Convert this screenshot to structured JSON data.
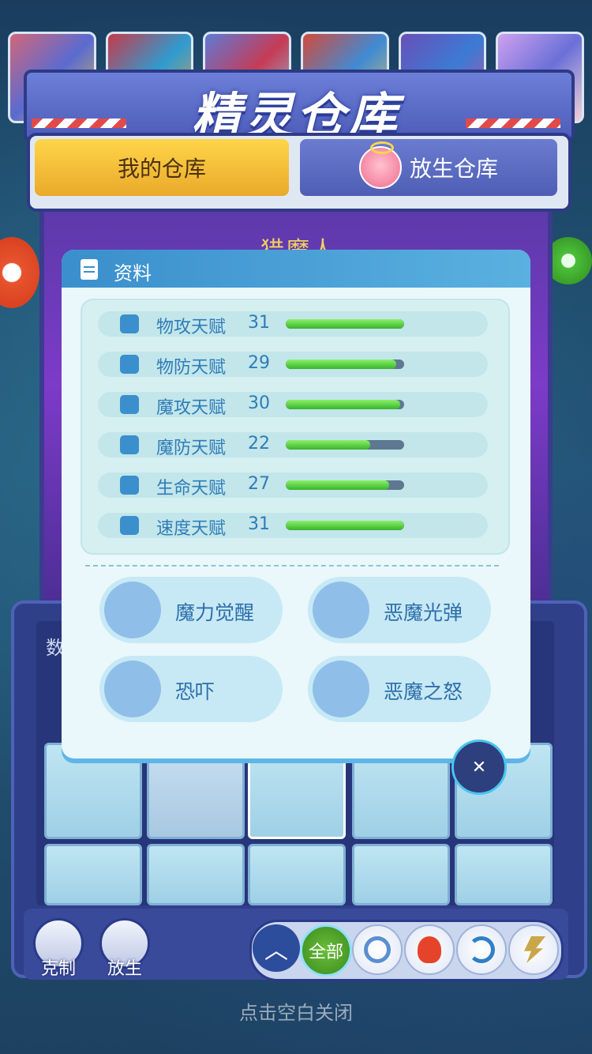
{
  "title": "精灵仓库",
  "tabs": {
    "mine": "我的仓库",
    "release": "放生仓库"
  },
  "spirit_name": "猎魔人",
  "modal": {
    "title": "资料",
    "stats": [
      {
        "label": "物攻天赋",
        "value": "31",
        "level": 1.0,
        "icon": "sword-icon"
      },
      {
        "label": "物防天赋",
        "value": "29",
        "level": 0.935,
        "icon": "shield-icon"
      },
      {
        "label": "魔攻天赋",
        "value": "30",
        "level": 0.968,
        "icon": "flame-icon"
      },
      {
        "label": "魔防天赋",
        "value": "22",
        "level": 0.71,
        "icon": "magic-shield-icon"
      },
      {
        "label": "生命天赋",
        "value": "27",
        "level": 0.87,
        "icon": "heart-plus-icon"
      },
      {
        "label": "速度天赋",
        "value": "31",
        "level": 1.0,
        "icon": "boot-icon"
      }
    ],
    "skills": [
      "魔力觉醒",
      "恶魔光弹",
      "恐吓",
      "恶魔之怒"
    ]
  },
  "grid": {
    "label": "数"
  },
  "actions": {
    "counter": "克制",
    "release": "放生"
  },
  "filter": {
    "all": "全部"
  },
  "close_hint": "点击空白关闭",
  "colors": {
    "bar_fill": "#4ccf3c",
    "bar_track": "#5d7890",
    "accent": "#3a8fcc",
    "tab_active": "#f0c23a"
  }
}
